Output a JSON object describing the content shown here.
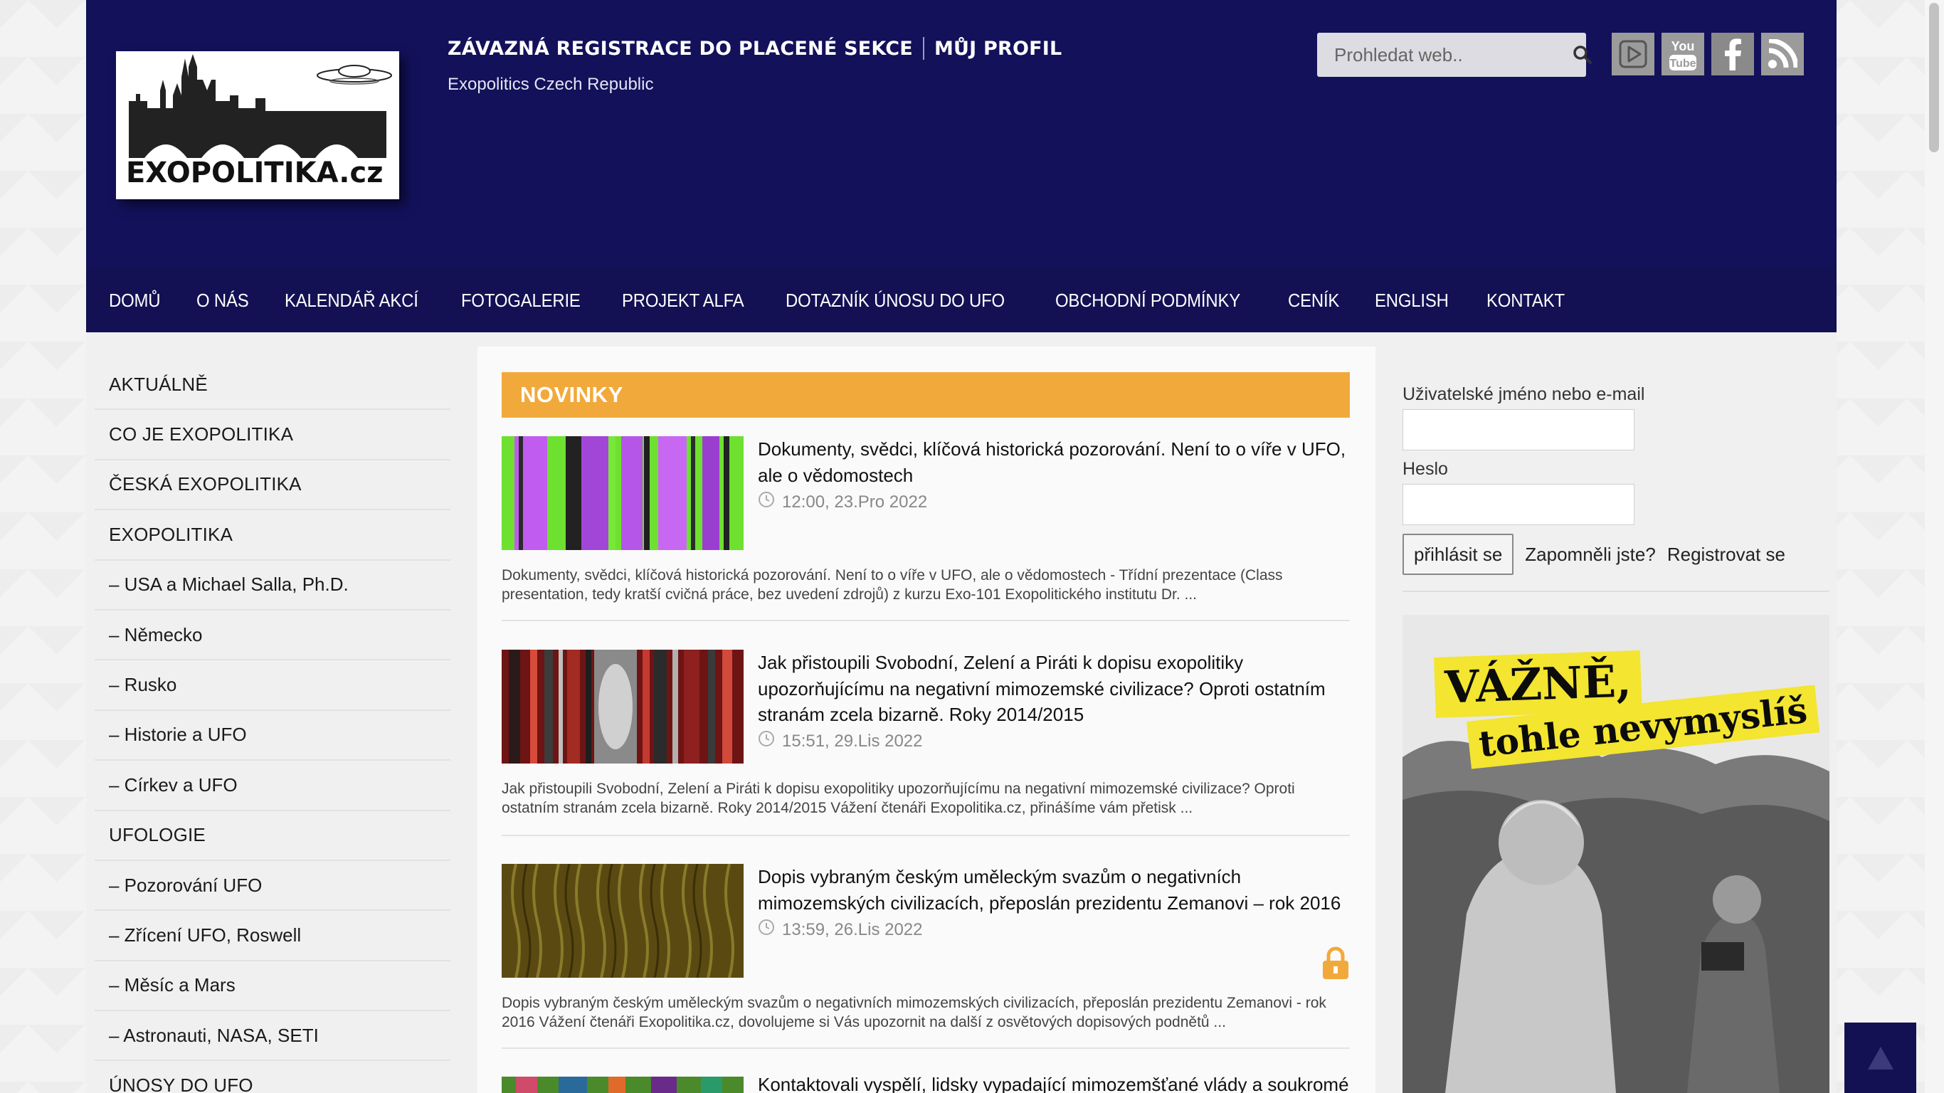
{
  "header": {
    "logo_text": "EXOPOLITIKA.cz",
    "top_links": [
      "ZÁVAZNÁ REGISTRACE DO PLACENÉ SEKCE",
      "MŮJ PROFIL"
    ],
    "tagline": "Exopolitics Czech Republic",
    "search_placeholder": "Prohledat web..",
    "social_icons": [
      "rumble-icon",
      "youtube-icon",
      "facebook-icon",
      "rss-icon"
    ],
    "youtube_label_top": "You",
    "youtube_label_bottom": "Tube"
  },
  "nav": {
    "items": [
      "DOMŮ",
      "O NÁS",
      "KALENDÁŘ AKCÍ",
      "FOTOGALERIE",
      "PROJEKT ALFA",
      "DOTAZNÍK ÚNOSU DO UFO",
      "OBCHODNÍ PODMÍNKY",
      "CENÍK",
      "ENGLISH",
      "KONTAKT"
    ]
  },
  "sidebar": {
    "items": [
      "AKTUÁLNĚ",
      "CO JE EXOPOLITIKA",
      "ČESKÁ EXOPOLITIKA",
      "EXOPOLITIKA",
      "– USA a Michael Salla, Ph.D.",
      "– Německo",
      "– Rusko",
      "– Historie a UFO",
      "– Církev a UFO",
      "UFOLOGIE",
      "– Pozorování UFO",
      "– Zřícení UFO, Roswell",
      "– Měsíc a Mars",
      "– Astronauti, NASA, SETI",
      "ÚNOSY DO UFO"
    ]
  },
  "main": {
    "section_title": "NOVINKY",
    "articles": [
      {
        "title": "Dokumenty, svědci, klíčová historická pozorování. Není to o víře v UFO, ale o vědomostech",
        "date": "12:00, 23.Pro 2022",
        "excerpt": "Dokumenty, svědci, klíčová historická pozorování. Není to o víře v UFO, ale o vědomostech - Třídní prezentace (Class presentation, tedy kratší cvičná práce, bez uvedení zdrojů) z kurzu Exo-101 Exopolitického institutu Dr. ..."
      },
      {
        "title": "Jak přistoupili Svobodní, Zelení a Piráti k dopisu exopolitiky upozorňujícímu na negativní mimozemské civilizace? Oproti ostatním stranám zcela bizarně. Roky 2014/2015",
        "date": "15:51, 29.Lis 2022",
        "excerpt": "Jak přistoupili Svobodní, Zelení a Piráti k dopisu exopolitiky upozorňujícímu na negativní mimozemské civilizace? Oproti ostatním stranám zcela bizarně. Roky 2014/2015 Vážení čtenáři Exopolitika.cz, přinášíme vám přetisk ..."
      },
      {
        "title": "Dopis vybraným českým uměleckým svazům o negativních mimozemských civilizacích, přeposlán prezidentu Zemanovi – rok 2016",
        "date": "13:59, 26.Lis 2022",
        "excerpt": "Dopis vybraným českým uměleckým svazům o negativních mimozemských civilizacích, přeposlán prezidentu Zemanovi - rok 2016 Vážení čtenáři Exopolitika.cz, dovolujeme si Vás upozornit na další z osvětových dopisových podnětů ..."
      },
      {
        "title": "Kontaktovali vyspělí, lidsky vypadající mimozemšťané vlády a soukromé",
        "date": "",
        "excerpt": ""
      }
    ]
  },
  "login": {
    "username_label": "Uživatelské jméno nebo e-mail",
    "password_label": "Heslo",
    "submit_label": "přihlásit se",
    "forgot_label": "Zapomněli jste?",
    "register_label": "Registrovat se"
  },
  "ad": {
    "headline1": "VÁŽNĚ,",
    "headline2": "tohle nevymyslíš"
  },
  "colors": {
    "header_bg": "#13115a",
    "accent_orange": "#f2a93b"
  }
}
